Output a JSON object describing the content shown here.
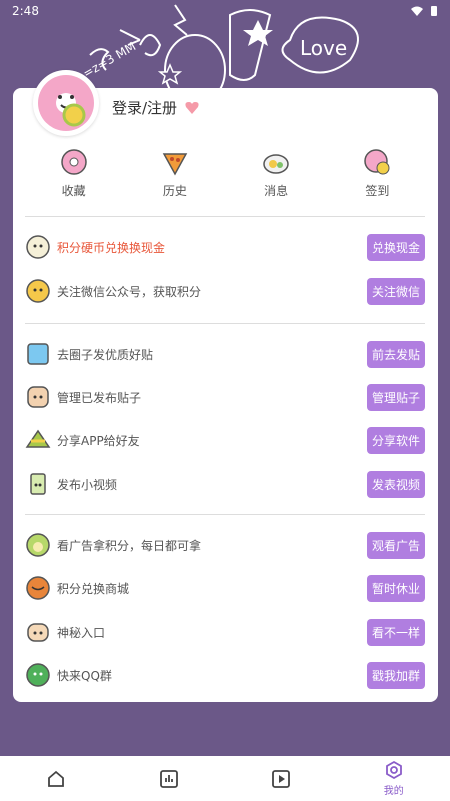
{
  "status": {
    "time": "2:48"
  },
  "header": {
    "deco_text": "Love",
    "deco_text2": "=z=3 MM"
  },
  "login": {
    "label": "登录/注册"
  },
  "quick": [
    {
      "label": "收藏",
      "icon": "donut-icon"
    },
    {
      "label": "历史",
      "icon": "pizza-icon"
    },
    {
      "label": "消息",
      "icon": "egg-plate-icon"
    },
    {
      "label": "签到",
      "icon": "donut-pink-icon"
    }
  ],
  "rows": [
    {
      "title": "积分硬币兑换换现金",
      "button": "兑换现金",
      "highlight": true,
      "icon": "robot-icon"
    },
    {
      "title": "关注微信公众号，获取积分",
      "button": "关注微信",
      "highlight": false,
      "icon": "yellow-face-icon"
    },
    {
      "title": "去圈子发优质好贴",
      "button": "前去发贴",
      "highlight": false,
      "icon": "blue-cube-icon"
    },
    {
      "title": "管理已发布贴子",
      "button": "管理贴子",
      "highlight": false,
      "icon": "bun-icon"
    },
    {
      "title": "分享APP给好友",
      "button": "分享软件",
      "highlight": false,
      "icon": "cake-slice-icon"
    },
    {
      "title": "发布小视频",
      "button": "发表视频",
      "highlight": false,
      "icon": "drink-cup-icon"
    },
    {
      "title": "看广告拿积分，每日都可拿",
      "button": "观看广告",
      "highlight": false,
      "icon": "green-blob-icon"
    },
    {
      "title": "积分兑换商城",
      "button": "暂时休业",
      "highlight": false,
      "icon": "orange-cookie-icon"
    },
    {
      "title": "神秘入口",
      "button": "看不一样",
      "highlight": false,
      "icon": "bread-icon"
    },
    {
      "title": "快来QQ群",
      "button": "戳我加群",
      "highlight": false,
      "icon": "green-leaf-icon"
    }
  ],
  "nav": [
    {
      "label": "",
      "icon": "home-icon"
    },
    {
      "label": "",
      "icon": "chart-icon"
    },
    {
      "label": "",
      "icon": "play-icon"
    },
    {
      "label": "我的",
      "icon": "profile-hex-icon"
    }
  ],
  "colors": {
    "background": "#6b5888",
    "accent": "#b07ee0",
    "highlight": "#e8573a",
    "nav_active": "#8a5cc9"
  }
}
